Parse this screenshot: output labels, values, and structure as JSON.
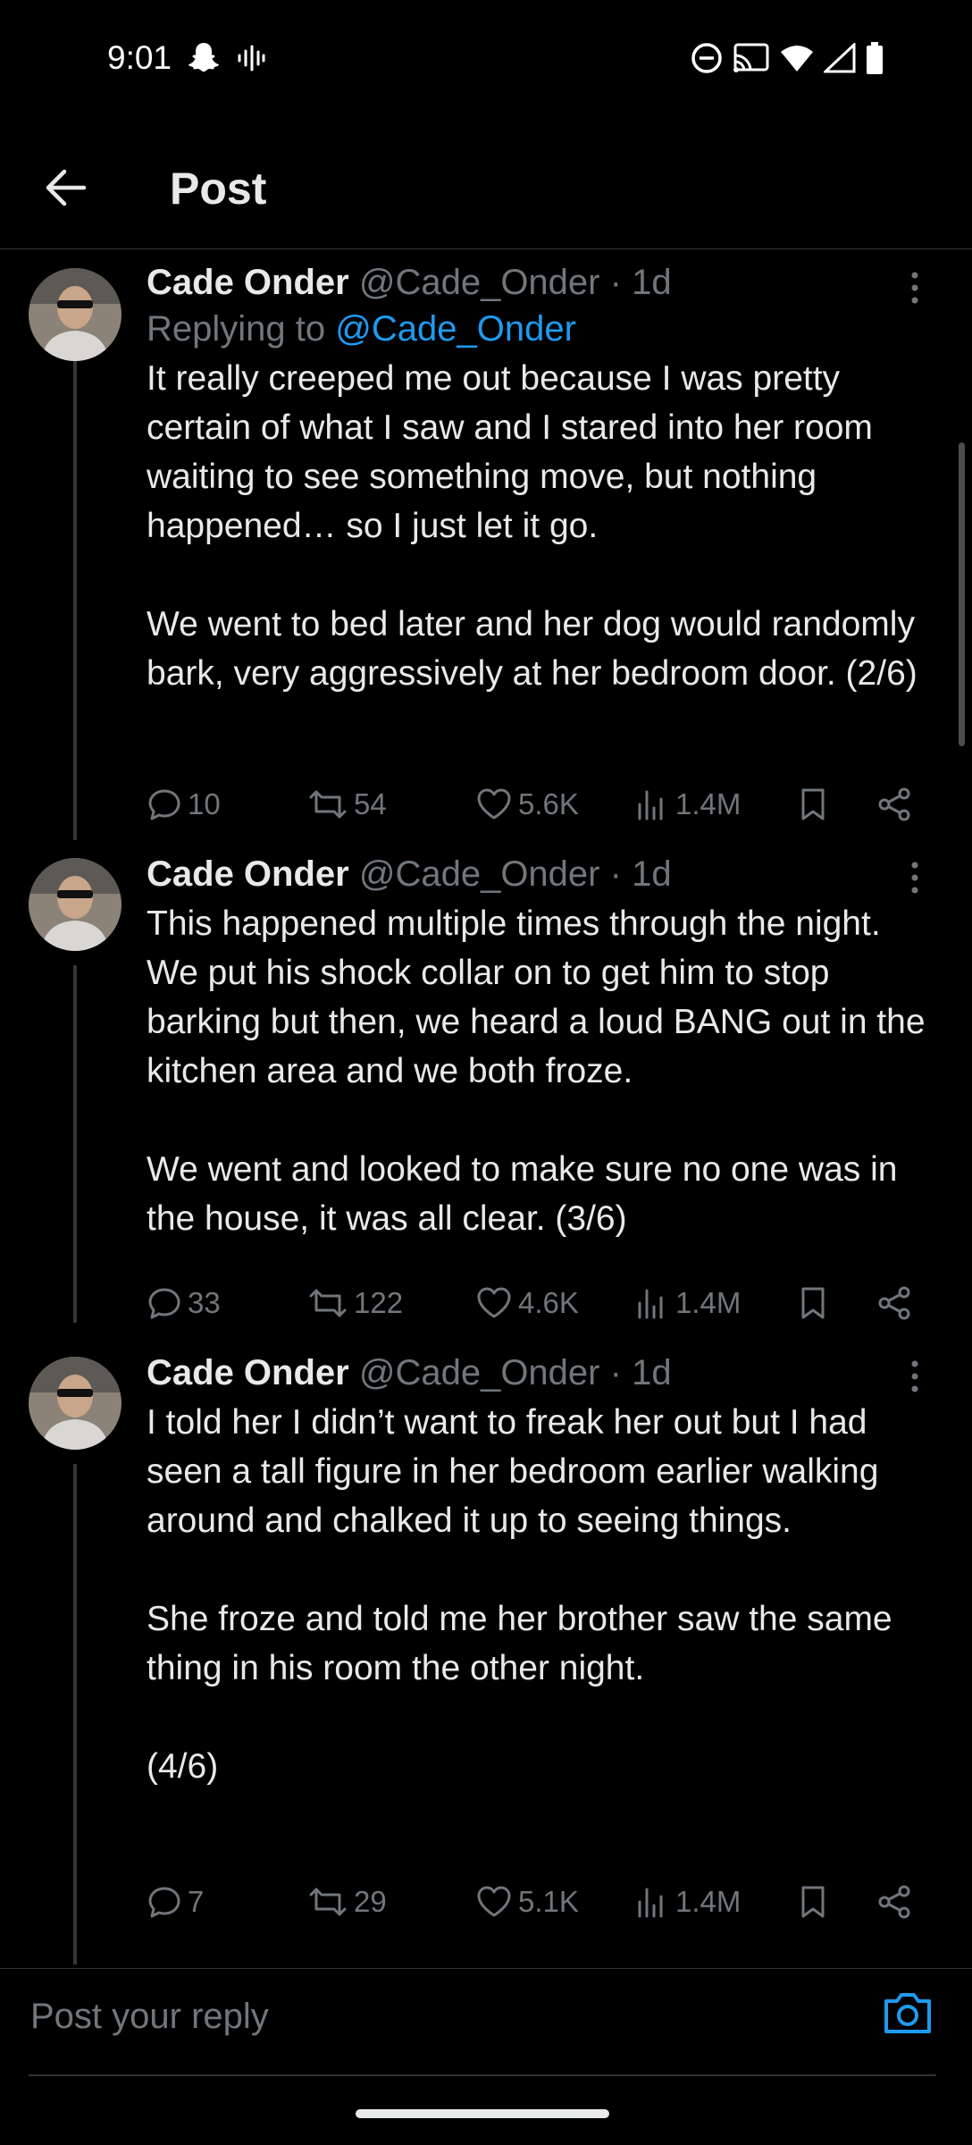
{
  "status_bar": {
    "time": "9:01",
    "left_icons": [
      "snapchat-icon",
      "voice-icon"
    ],
    "right_icons": [
      "do-not-disturb-icon",
      "cast-icon",
      "wifi-icon",
      "signal-icon",
      "battery-icon"
    ]
  },
  "header": {
    "title": "Post",
    "back_icon": "arrow-left-icon"
  },
  "tweets": [
    {
      "author_name": "Cade Onder",
      "author_handle": "@Cade_Onder",
      "separator": "·",
      "time": "1d",
      "replying_prefix": "Replying to ",
      "replying_to": "@Cade_Onder",
      "text": "It really creeped me out because I was pretty certain of what I saw and I stared into her room waiting to see something move, but nothing happened… so I just let it go.\n\nWe went to bed later and her dog would randomly bark, very aggressively at her bedroom door. (2/6)",
      "replies": "10",
      "reposts": "54",
      "likes": "5.6K",
      "views": "1.4M"
    },
    {
      "author_name": "Cade Onder",
      "author_handle": "@Cade_Onder",
      "separator": "·",
      "time": "1d",
      "text": "This happened multiple times through the night. We put his shock collar on to get him to stop barking but then, we heard a loud BANG out in the kitchen area and we both froze.\n\nWe went and looked to make sure no one was in the house, it was all clear. (3/6)",
      "replies": "33",
      "reposts": "122",
      "likes": "4.6K",
      "views": "1.4M"
    },
    {
      "author_name": "Cade Onder",
      "author_handle": "@Cade_Onder",
      "separator": "·",
      "time": "1d",
      "text": "I told her I didn’t want to freak her out but I had seen a tall figure in her bedroom earlier walking around and chalked it up to seeing things.\n\nShe froze and told me her brother saw the same thing in his room the other night.\n\n(4/6)",
      "replies": "7",
      "reposts": "29",
      "likes": "5.1K",
      "views": "1.4M"
    }
  ],
  "reply_bar": {
    "placeholder": "Post your reply",
    "camera_icon": "camera-icon"
  },
  "colors": {
    "background": "#000000",
    "text": "#e7e9ea",
    "muted": "#71767b",
    "accent": "#1d9bf0",
    "divider": "#2f3336"
  }
}
